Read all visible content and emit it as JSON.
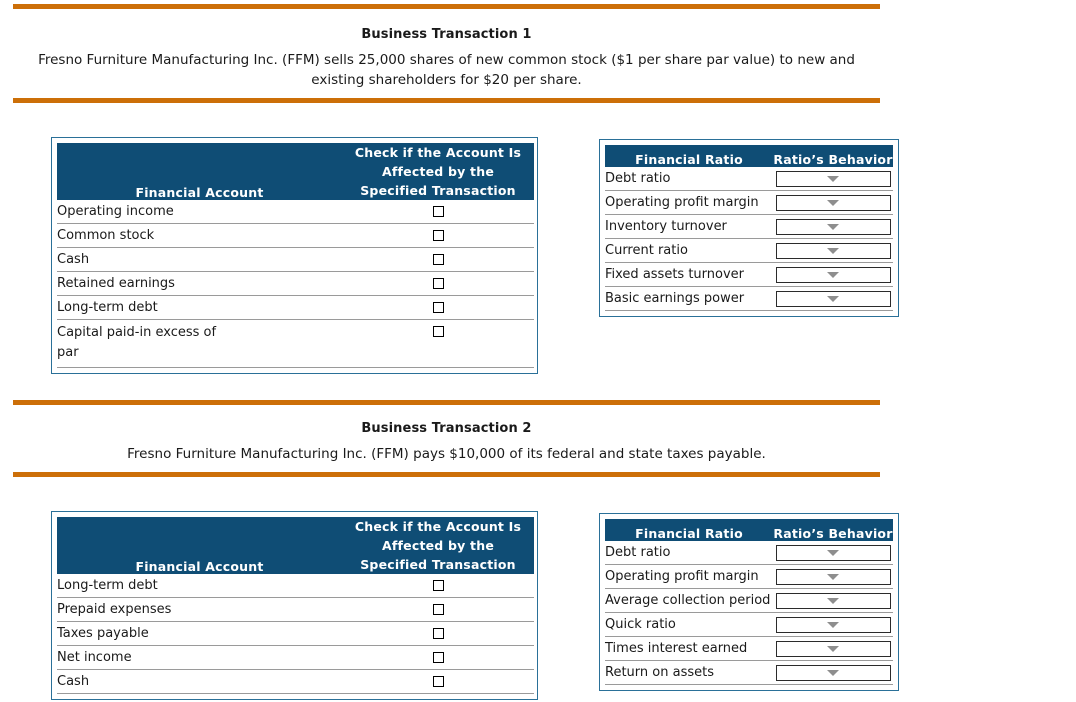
{
  "theme": {
    "rule_color": "#cc6f08",
    "header_bg": "#0f4d75",
    "card_border": "#2a7098",
    "row_divider": "#9a9a9a",
    "arrow_color": "#8e8e8e"
  },
  "sections": [
    {
      "title": "Business Transaction 1",
      "description": "Fresno Furniture Manufacturing Inc. (FFM) sells 25,000 shares of new common stock ($1 per share par value) to new and existing shareholders for $20 per share.",
      "accounts_table": {
        "header_col1": "Financial Account",
        "header_col2_line1": "Check if the Account Is Affected by the",
        "header_col2_line2": "Specified Transaction",
        "rows": [
          {
            "account": "Operating income",
            "checked": false
          },
          {
            "account": "Common stock",
            "checked": false
          },
          {
            "account": "Cash",
            "checked": false
          },
          {
            "account": "Retained earnings",
            "checked": false
          },
          {
            "account": "Long-term debt",
            "checked": false
          },
          {
            "account": "Capital paid-in excess of par",
            "checked": false
          }
        ]
      },
      "ratios_table": {
        "header_col1": "Financial Ratio",
        "header_col2": "Ratio’s Behavior",
        "rows": [
          {
            "ratio": "Debt ratio",
            "behavior": ""
          },
          {
            "ratio": "Operating profit margin",
            "behavior": ""
          },
          {
            "ratio": "Inventory turnover",
            "behavior": ""
          },
          {
            "ratio": "Current ratio",
            "behavior": ""
          },
          {
            "ratio": "Fixed assets turnover",
            "behavior": ""
          },
          {
            "ratio": "Basic earnings power",
            "behavior": ""
          }
        ]
      }
    },
    {
      "title": "Business Transaction 2",
      "description": "Fresno Furniture Manufacturing Inc. (FFM) pays $10,000 of its federal and state taxes payable.",
      "accounts_table": {
        "header_col1": "Financial Account",
        "header_col2_line1": "Check if the Account Is Affected by the",
        "header_col2_line2": "Specified Transaction",
        "rows": [
          {
            "account": "Long-term debt",
            "checked": false
          },
          {
            "account": "Prepaid expenses",
            "checked": false
          },
          {
            "account": "Taxes payable",
            "checked": false
          },
          {
            "account": "Net income",
            "checked": false
          },
          {
            "account": "Cash",
            "checked": false
          }
        ]
      },
      "ratios_table": {
        "header_col1": "Financial Ratio",
        "header_col2": "Ratio’s Behavior",
        "rows": [
          {
            "ratio": "Debt ratio",
            "behavior": ""
          },
          {
            "ratio": "Operating profit margin",
            "behavior": ""
          },
          {
            "ratio": "Average collection period",
            "behavior": ""
          },
          {
            "ratio": "Quick ratio",
            "behavior": ""
          },
          {
            "ratio": "Times interest earned",
            "behavior": ""
          },
          {
            "ratio": "Return on assets",
            "behavior": ""
          }
        ]
      }
    }
  ]
}
